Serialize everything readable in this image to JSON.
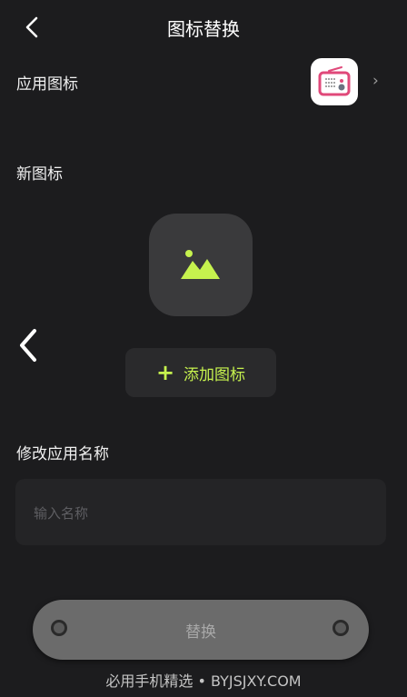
{
  "header": {
    "title": "图标替换"
  },
  "app_icon_row": {
    "label": "应用图标",
    "icon": "radio-app-icon"
  },
  "new_icon": {
    "label": "新图标",
    "placeholder_icon": "image-icon",
    "add_button_label": "添加图标"
  },
  "rename": {
    "label": "修改应用名称",
    "input_placeholder": "输入名称",
    "input_value": ""
  },
  "action": {
    "replace_label": "替换"
  },
  "watermark": "必用手机精选 • BYJSJXY.COM",
  "colors": {
    "accent": "#c6f24e",
    "background": "#1c1c1e",
    "card": "#3a3a3c",
    "app_icon_pink": "#e0497a"
  }
}
